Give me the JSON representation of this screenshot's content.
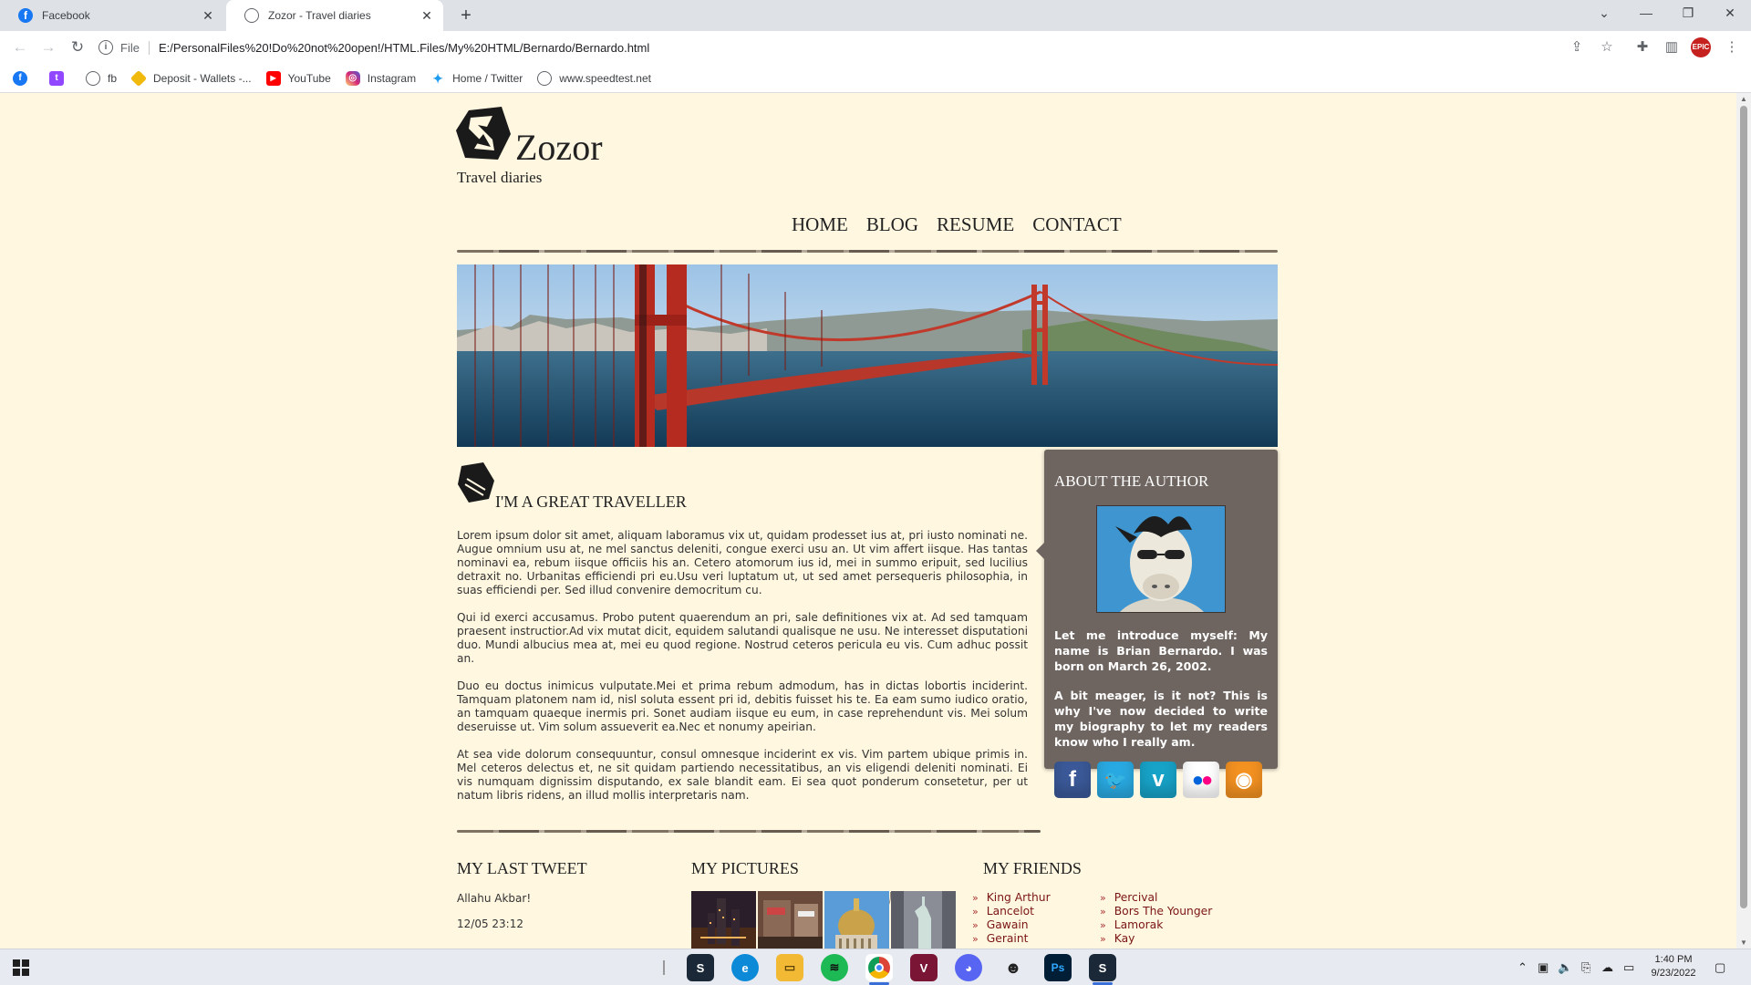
{
  "browser": {
    "tabs": [
      {
        "label": "Facebook",
        "favicon_color": "#1877f2",
        "active": false
      },
      {
        "label": "Zozor - Travel diaries",
        "favicon_color": "#5f6368",
        "active": true
      }
    ],
    "url_scheme": "File",
    "url": "E:/PersonalFiles%20!Do%20not%20open!/HTML.Files/My%20HTML/Bernardo/Bernardo.html",
    "bookmarks": [
      {
        "label": "",
        "icon": "facebook-icon",
        "color": "#1877f2"
      },
      {
        "label": "",
        "icon": "twitch-icon",
        "color": "#9146ff"
      },
      {
        "label": "fb",
        "icon": "globe-icon",
        "color": "#5f6368"
      },
      {
        "label": "Deposit - Wallets -...",
        "icon": "binance-icon",
        "color": "#f0b90b"
      },
      {
        "label": "YouTube",
        "icon": "youtube-icon",
        "color": "#ff0000"
      },
      {
        "label": "Instagram",
        "icon": "instagram-icon",
        "color": "#d6249f"
      },
      {
        "label": "Home / Twitter",
        "icon": "twitter-icon",
        "color": "#1d9bf0"
      },
      {
        "label": "www.speedtest.net",
        "icon": "globe-icon",
        "color": "#5f6368"
      }
    ]
  },
  "site": {
    "brand": "Zozor",
    "tagline": "Travel diaries",
    "nav": [
      "HOME",
      "BLOG",
      "RESUME",
      "CONTACT"
    ],
    "section_title": "I'M A GREAT TRAVELLER",
    "paragraphs": [
      "Lorem ipsum dolor sit amet, aliquam laboramus vix ut, quidam prodesset ius at, pri iusto nominati ne. Augue omnium usu at, ne mel sanctus deleniti, congue exerci usu an. Ut vim affert iisque. Has tantas nominavi ea, rebum iisque officiis his an. Cetero atomorum ius id, mei in summo eripuit, sed lucilius detraxit no. Urbanitas efficiendi pri eu.Usu veri luptatum ut, ut sed amet persequeris philosophia, in suas efficiendi per. Sed illud convenire democritum cu.",
      "Qui id exerci accusamus. Probo putent quaerendum an pri, sale definitiones vix at. Ad sed tamquam praesent instructior.Ad vix mutat dicit, equidem salutandi qualisque ne usu. Ne interesset disputationi duo. Mundi albucius mea at, mei eu quod regione. Nostrud ceteros pericula eu vis. Cum adhuc possit an.",
      "Duo eu doctus inimicus vulputate.Mei et prima rebum admodum, has in dictas lobortis inciderint. Tamquam platonem nam id, nisl soluta essent pri id, debitis fuisset his te. Ea eam sumo iudico oratio, an tamquam quaeque inermis pri. Sonet audiam iisque eu eum, in case reprehendunt vis. Mei solum deseruisse ut. Vim solum assueverit ea.Nec et nonumy apeirian.",
      "At sea vide dolorum consequuntur, consul omnesque inciderint ex vis. Vim partem ubique primis in. Mel ceteros delectus et, ne sit quidam partiendo necessitatibus, an vis eligendi deleniti nominati. Ei vis numquam dignissim disputando, ex sale blandit eam. Ei sea quot ponderum consetetur, per ut natum libris ridens, an illud mollis interpretaris nam."
    ],
    "author": {
      "title": "ABOUT THE AUTHOR",
      "p1": "Let me introduce myself: My name is Brian Bernardo. I was born on March 26, 2002.",
      "p2": "A bit meager, is it not? This is why I've now decided to write my biography to let my readers know who I really am.",
      "socials": [
        {
          "name": "facebook-icon",
          "glyph": "f",
          "color": "#3b5998"
        },
        {
          "name": "twitter-icon",
          "glyph": "t",
          "color": "#29a9e1"
        },
        {
          "name": "vimeo-icon",
          "glyph": "v",
          "color": "#17a2c7"
        },
        {
          "name": "flickr-icon",
          "glyph": "••",
          "color": "#ffffff"
        },
        {
          "name": "rss-icon",
          "glyph": ")",
          "color": "#f39121"
        }
      ]
    },
    "footer": {
      "tweet_title": "MY LAST TWEET",
      "tweet_text": "Allahu Akbar!",
      "tweet_time": "12/05 23:12",
      "pictures_title": "MY PICTURES",
      "friends_title": "MY FRIENDS",
      "friends_col1": [
        "King Arthur",
        "Lancelot",
        "Gawain",
        "Geraint"
      ],
      "friends_col2": [
        "Percival",
        "Bors The Younger",
        "Lamorak",
        "Kay"
      ]
    }
  },
  "taskbar": {
    "apps": [
      {
        "name": "steam-taskbar-icon",
        "color": "#1b2838",
        "glyph": "S",
        "underline": false
      },
      {
        "name": "edge-taskbar-icon",
        "color": "#0c8ad8",
        "glyph": "e",
        "underline": false
      },
      {
        "name": "file-explorer-taskbar-icon",
        "color": "#f2b935",
        "glyph": "▭",
        "underline": false
      },
      {
        "name": "spotify-taskbar-icon",
        "color": "#1db954",
        "glyph": "≋",
        "underline": false
      },
      {
        "name": "chrome-taskbar-icon",
        "color": "#db4437",
        "glyph": "◉",
        "underline": true
      },
      {
        "name": "app-taskbar-icon",
        "color": "#7a1535",
        "glyph": "V",
        "underline": false
      },
      {
        "name": "discord-taskbar-icon",
        "color": "#5865f2",
        "glyph": "◕",
        "underline": false
      },
      {
        "name": "game-taskbar-icon",
        "color": "#222222",
        "glyph": "☻",
        "underline": false
      },
      {
        "name": "photoshop-taskbar-icon",
        "color": "#001e36",
        "glyph": "Ps",
        "underline": false
      },
      {
        "name": "steam2-taskbar-icon",
        "color": "#1b2838",
        "glyph": "S",
        "underline": true
      }
    ],
    "time": "1:40 PM",
    "date": "9/23/2022"
  }
}
